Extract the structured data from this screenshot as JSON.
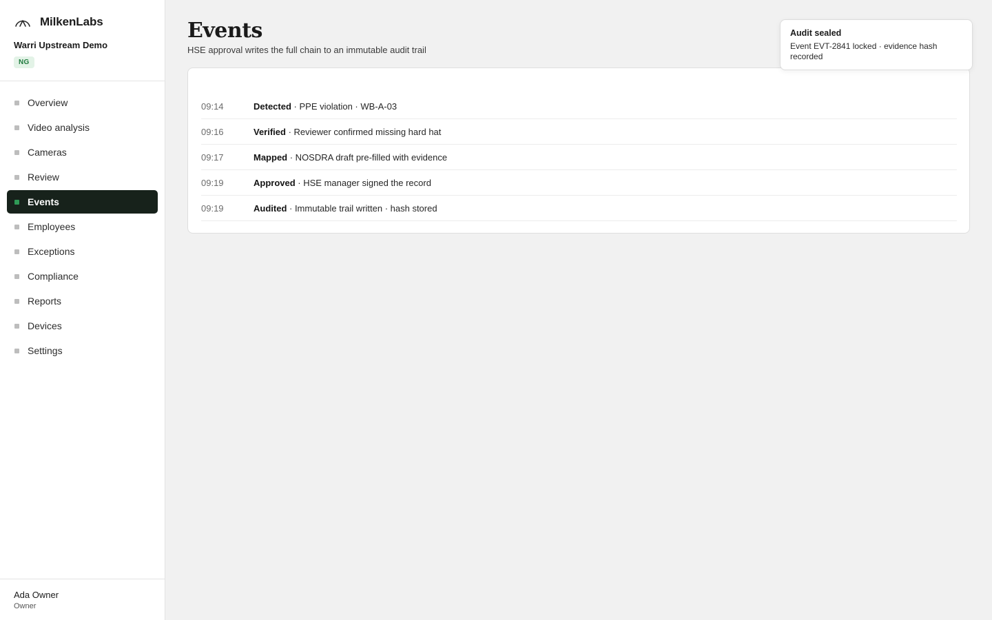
{
  "brand": {
    "name": "MilkenLabs",
    "icon": "mountain-arc-icon"
  },
  "org": {
    "name": "Warri Upstream Demo",
    "region_badge": "NG"
  },
  "colors": {
    "accent_green": "#2f9a56",
    "active_nav_bg": "#17221b",
    "badge_bg": "#e3f3e7",
    "badge_text": "#1f7a3d"
  },
  "sidebar": {
    "items": [
      {
        "label": "Overview",
        "active": false
      },
      {
        "label": "Video analysis",
        "active": false
      },
      {
        "label": "Cameras",
        "active": false
      },
      {
        "label": "Review",
        "active": false
      },
      {
        "label": "Events",
        "active": true
      },
      {
        "label": "Employees",
        "active": false
      },
      {
        "label": "Exceptions",
        "active": false
      },
      {
        "label": "Compliance",
        "active": false
      },
      {
        "label": "Reports",
        "active": false
      },
      {
        "label": "Devices",
        "active": false
      },
      {
        "label": "Settings",
        "active": false
      }
    ]
  },
  "user": {
    "name": "Ada Owner",
    "role": "Owner"
  },
  "main": {
    "title": "Events",
    "subtitle": "HSE approval writes the full chain to an immutable audit trail",
    "timeline": [
      {
        "time": "09:14",
        "stage": "Detected",
        "detail": " · PPE violation · WB-A-03"
      },
      {
        "time": "09:16",
        "stage": "Verified",
        "detail": " · Reviewer confirmed missing hard hat"
      },
      {
        "time": "09:17",
        "stage": "Mapped",
        "detail": " · NOSDRA draft pre-filled with evidence"
      },
      {
        "time": "09:19",
        "stage": "Approved",
        "detail": " · HSE manager signed the record"
      },
      {
        "time": "09:19",
        "stage": "Audited",
        "detail": " · Immutable trail written · hash stored"
      }
    ]
  },
  "toast": {
    "title": "Audit sealed",
    "body": "Event EVT-2841 locked · evidence hash recorded"
  }
}
